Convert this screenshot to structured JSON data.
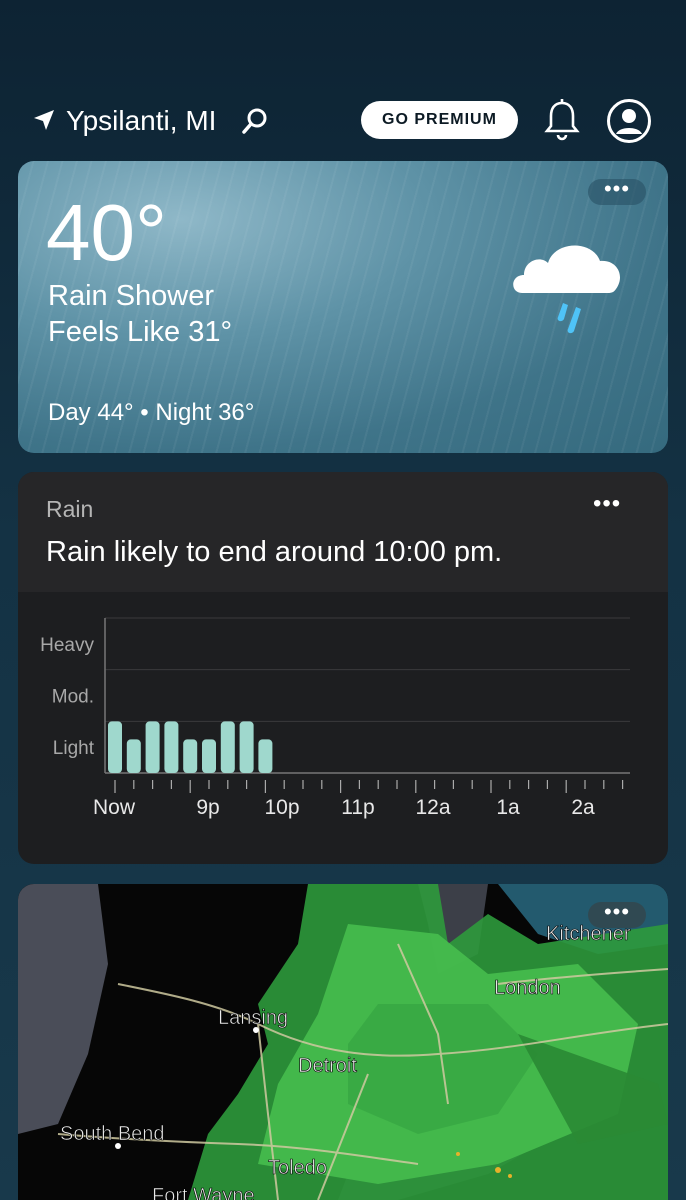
{
  "header": {
    "location": "Ypsilanti, MI",
    "premium_label": "GO PREMIUM"
  },
  "current": {
    "temperature": "40°",
    "condition": "Rain Shower",
    "feels_like": "Feels Like 31°",
    "day_night": "Day 44° • Night 36°",
    "icon": "rain-cloud-icon"
  },
  "rain": {
    "title": "Rain",
    "summary": "Rain likely to end around 10:00 pm.",
    "more": "•••",
    "chart_data": {
      "type": "bar",
      "y_levels": [
        "Heavy",
        "Mod.",
        "Light"
      ],
      "x_tick_labels": [
        "Now",
        "9p",
        "10p",
        "11p",
        "12a",
        "1a",
        "2a"
      ],
      "values": [
        1.0,
        0.65,
        1.0,
        1.0,
        0.65,
        0.65,
        1.0,
        1.0,
        0.65,
        0,
        0,
        0,
        0,
        0,
        0,
        0,
        0,
        0,
        0,
        0,
        0,
        0,
        0,
        0,
        0,
        0,
        0,
        0
      ],
      "ylim": [
        0,
        3
      ],
      "bar_color": "#9fd8cd"
    }
  },
  "map": {
    "labels": [
      "Kitchener",
      "London",
      "Lansing",
      "Detroit",
      "South Bend",
      "Toledo",
      "Fort Wayne"
    ]
  },
  "colors": {
    "accent_blue": "#4fc3f7",
    "card_dark": "#1d1e20"
  }
}
